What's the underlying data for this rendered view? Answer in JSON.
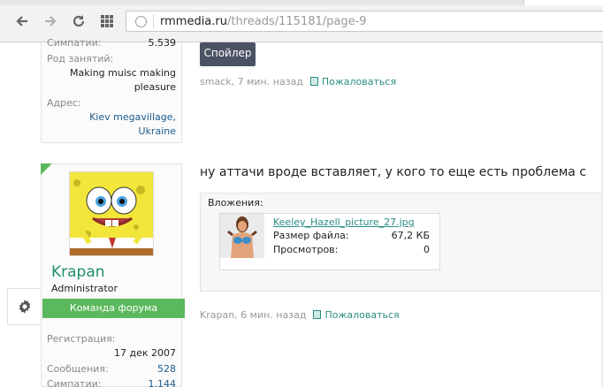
{
  "browser": {
    "url_host": "rmmedia.ru",
    "url_path": "/threads/115181/page-9"
  },
  "prev_user": {
    "sympathy_label": "Симпатии:",
    "sympathy_value": "5.539",
    "occupation_label": "Род занятий:",
    "occupation_line1": "Making muisc making",
    "occupation_line2": "pleasure",
    "address_label": "Адрес:",
    "address_line1": "Kiev megavillage,",
    "address_line2": "Ukraine"
  },
  "post1": {
    "spoiler_label": "Спойлер",
    "author": "smack",
    "time": "7 мин. назад",
    "report_label": "Пожаловаться"
  },
  "user2": {
    "name": "Krapan",
    "title": "Administrator",
    "badge": "Команда форума",
    "reg_label": "Регистрация:",
    "reg_value": "17 дек 2007",
    "msgs_label": "Сообщения:",
    "msgs_value": "528",
    "sympathy_label": "Симпатии:",
    "sympathy_value": "1.144"
  },
  "post2": {
    "text": "ну аттачи вроде вставляет, у кого то еще есть проблема с",
    "attachments_title": "Вложения:",
    "file_name": "Keeley_Hazell_picture_27.jpg",
    "size_label": "Размер файла:",
    "size_value": "67,2 КБ",
    "views_label": "Просмотров:",
    "views_value": "0",
    "author": "Krapan",
    "time": "6 мин. назад",
    "report_label": "Пожаловаться"
  },
  "icons": {
    "back": "arrow-left-icon",
    "forward": "arrow-right-icon",
    "reload": "reload-icon",
    "apps": "apps-grid-icon",
    "site": "globe-icon",
    "settings": "gear-icon",
    "report": "book-icon"
  },
  "colors": {
    "accent_green": "#5cb85c",
    "link_teal": "#2a8f80",
    "username": "#1f8f6e",
    "spoiler_bg": "#4b5263"
  }
}
